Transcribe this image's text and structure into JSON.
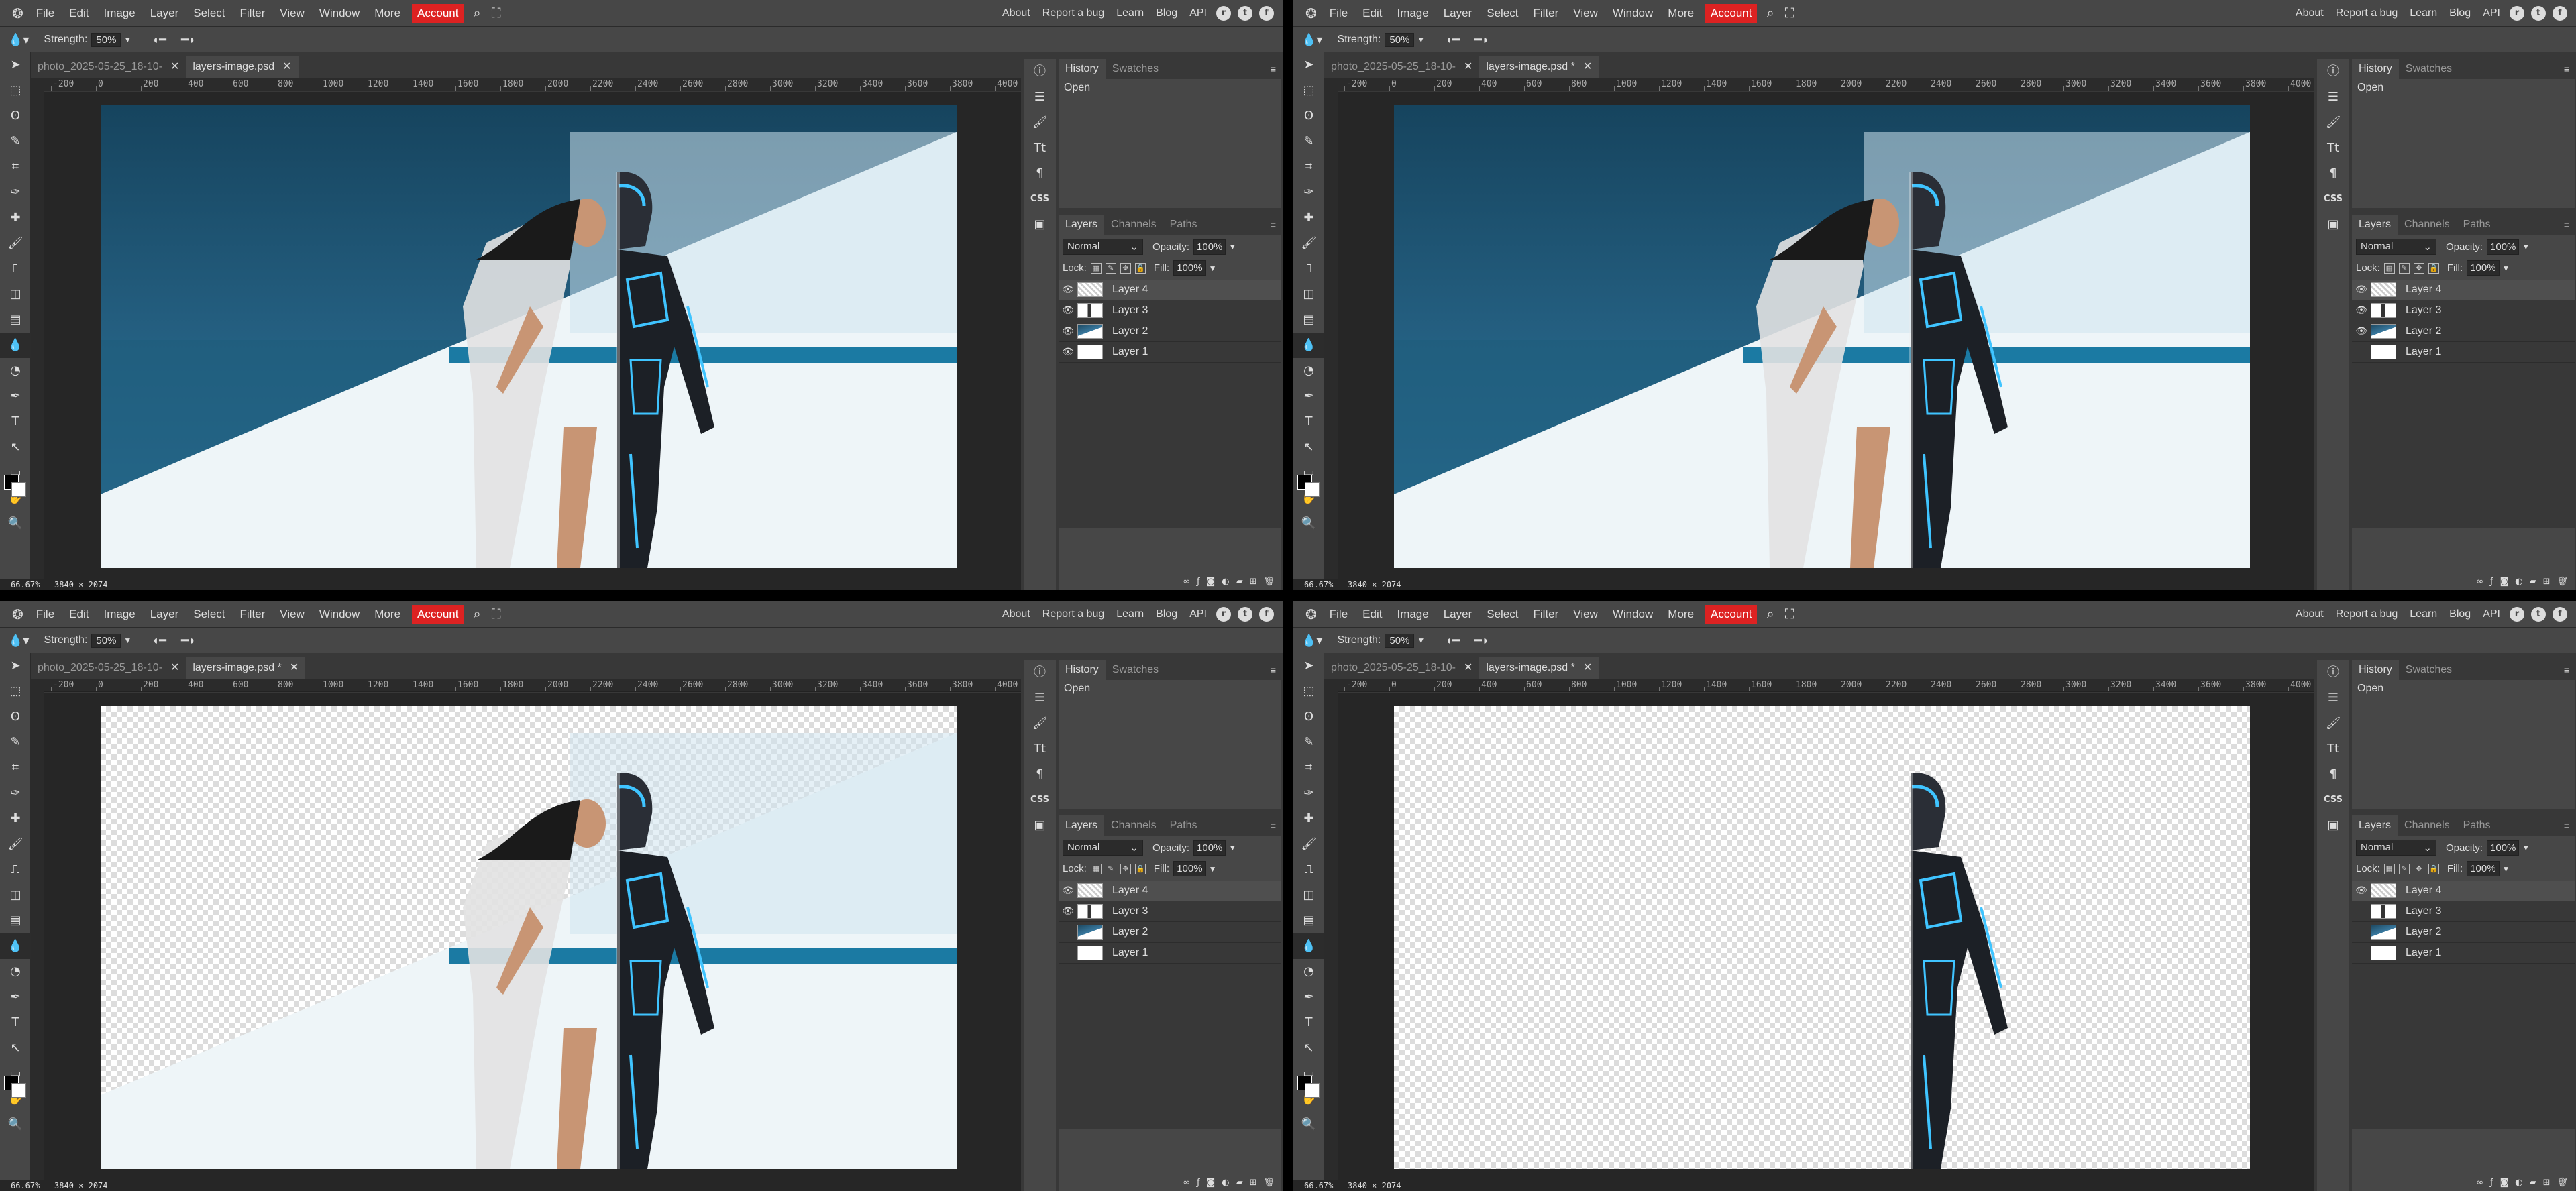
{
  "app": {
    "menu": [
      "File",
      "Edit",
      "Image",
      "Layer",
      "Select",
      "Filter",
      "View",
      "Window",
      "More"
    ],
    "account": "Account",
    "right_links": [
      "About",
      "Report a bug",
      "Learn",
      "Blog",
      "API"
    ],
    "social_icons": [
      "reddit-icon",
      "twitter-icon",
      "facebook-icon"
    ]
  },
  "options": {
    "strength_label": "Strength:",
    "strength_value": "50%"
  },
  "tabs": [
    "photo_2025-05-25_18-10-",
    "layers-image.psd"
  ],
  "ruler_ticks": [
    "-200",
    "0",
    "200",
    "400",
    "600",
    "800",
    "1000",
    "1200",
    "1400",
    "1600",
    "1800",
    "2000",
    "2200",
    "2400",
    "2600",
    "2800",
    "3000",
    "3200",
    "3400",
    "3600",
    "3800",
    "4000"
  ],
  "panels": {
    "history_tab": "History",
    "swatches_tab": "Swatches",
    "history_item": "Open",
    "layers_tab": "Layers",
    "channels_tab": "Channels",
    "paths_tab": "Paths",
    "blend_mode": "Normal",
    "opacity_label": "Opacity:",
    "opacity_value": "100%",
    "lock_label": "Lock:",
    "fill_label": "Fill:",
    "fill_value": "100%"
  },
  "statusbar": "66.67%   3840 × 2074",
  "layer_names": [
    "Layer 4",
    "Layer 3",
    "Layer 2",
    "Layer 1"
  ],
  "panes": [
    {
      "active_tab_title": "layers-image.psd",
      "visible": [
        true,
        true,
        true,
        true
      ]
    },
    {
      "active_tab_title": "layers-image.psd *",
      "visible": [
        true,
        true,
        true,
        false
      ]
    },
    {
      "active_tab_title": "layers-image.psd *",
      "visible": [
        true,
        true,
        false,
        false
      ]
    },
    {
      "active_tab_title": "layers-image.psd *",
      "visible": [
        true,
        false,
        false,
        false
      ]
    }
  ],
  "colors": {
    "menubar": "#474747",
    "workspace": "#262626",
    "account": "#dd2222",
    "sky": "#2a6c91",
    "sea": "#1b7aa3"
  }
}
